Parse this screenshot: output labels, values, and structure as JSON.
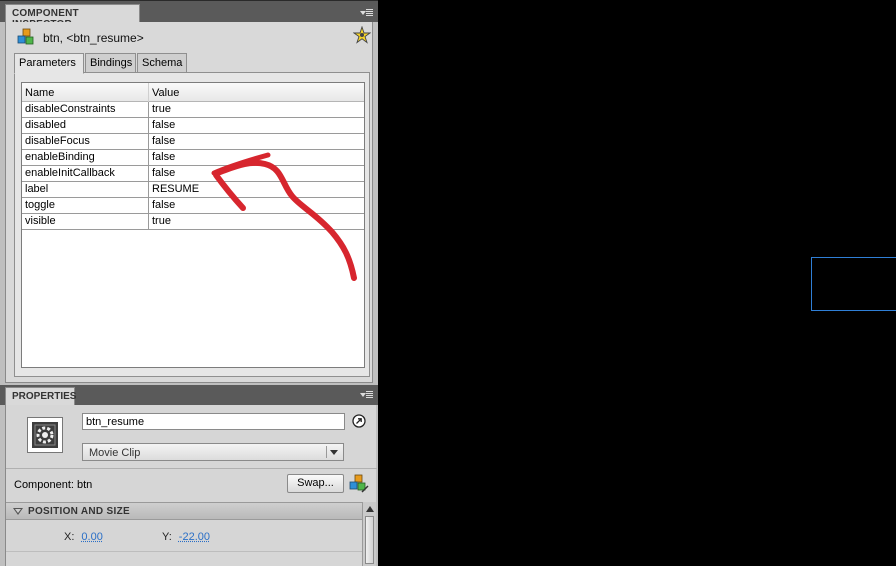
{
  "component_inspector": {
    "panel_title": "COMPONENT INSPECTOR",
    "component_title": "btn, <btn_resume>",
    "tabs": [
      "Parameters",
      "Bindings",
      "Schema"
    ],
    "active_tab": "Parameters",
    "grid": {
      "headers": {
        "name": "Name",
        "value": "Value"
      },
      "rows": [
        {
          "name": "disableConstraints",
          "value": "true"
        },
        {
          "name": "disabled",
          "value": "false"
        },
        {
          "name": "disableFocus",
          "value": "false"
        },
        {
          "name": "enableBinding",
          "value": "false"
        },
        {
          "name": "enableInitCallback",
          "value": "false"
        },
        {
          "name": "label",
          "value": "RESUME"
        },
        {
          "name": "toggle",
          "value": "false"
        },
        {
          "name": "visible",
          "value": "true"
        }
      ]
    }
  },
  "properties": {
    "panel_title": "PROPERTIES",
    "instance_name": "btn_resume",
    "symbol_type": "Movie Clip",
    "component_label": "Component: btn",
    "swap_label": "Swap...",
    "section_title": "POSITION AND SIZE",
    "x_label": "X:",
    "x_value": "0.00",
    "y_label": "Y:",
    "y_value": "-22.00"
  },
  "colors": {
    "annotation_arrow": "#d7262e",
    "stage_selection": "#2f7fd6",
    "numeric_link": "#2a6fc7"
  }
}
